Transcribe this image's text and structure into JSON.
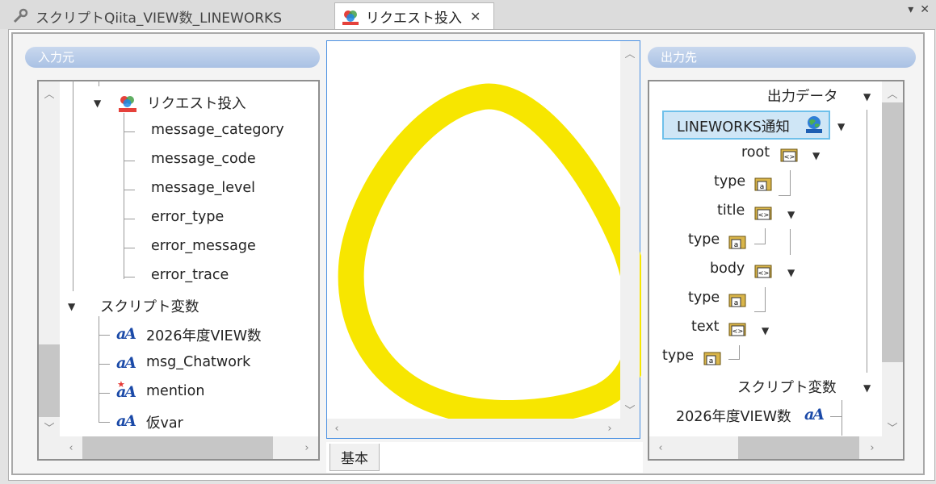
{
  "tabs": [
    {
      "label": "スクリプトQiita_VIEW数_LINEWORKS",
      "active": false
    },
    {
      "label": "リクエスト投入",
      "active": true
    }
  ],
  "window_controls": {
    "menu": "▾",
    "close": "✕"
  },
  "left_panel": {
    "header": "入力元",
    "tree": {
      "request_node": "リクエスト投入",
      "request_children": [
        "message_category",
        "message_code",
        "message_level",
        "error_type",
        "error_message",
        "error_trace"
      ],
      "script_vars_node": "スクリプト変数",
      "script_vars": [
        "2026年度VIEW数",
        "msg_Chatwork",
        "mention",
        "仮var"
      ]
    }
  },
  "center_panel": {
    "bottom_tab": "基本",
    "annotation_color": "#f7e600"
  },
  "right_panel": {
    "header": "出力先",
    "tree": {
      "output_data": "出力データ",
      "lineworks": "LINEWORKS通知",
      "root": "root",
      "type1": "type",
      "title": "title",
      "type2": "type",
      "body": "body",
      "type3": "type",
      "text": "text",
      "type4": "type",
      "script_vars": "スクリプト変数",
      "var1": "2026年度VIEW数"
    }
  },
  "icons": {
    "variable": "aA",
    "folder": "folder-xml-icon",
    "request": "request-icon",
    "globe": "globe-icon"
  },
  "colors": {
    "pill": "#a9c1e4",
    "selection_fill": "#cfe6f6",
    "selection_border": "#6fc0ea",
    "focus_border": "#4a90e2"
  }
}
